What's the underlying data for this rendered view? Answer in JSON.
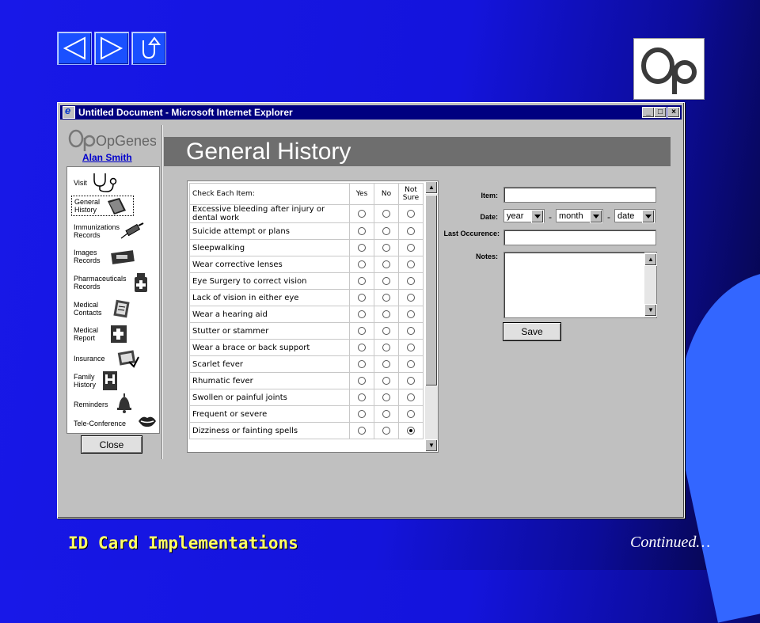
{
  "slide": {
    "footer_title": "ID Card Implementations",
    "footer_continued": "Continued…",
    "nav": {
      "prev_icon": "triangle-left-icon",
      "next_icon": "triangle-right-icon",
      "return_icon": "u-turn-icon"
    },
    "logo_text": "Op"
  },
  "window": {
    "title": "Untitled Document - Microsoft Internet Explorer",
    "controls": [
      "minimize",
      "maximize",
      "close"
    ]
  },
  "app": {
    "brand": "OpGenesis",
    "user_name": "Alan Smith",
    "page_title": "General History",
    "sidebar": [
      {
        "label": "Visit",
        "icon": "stethoscope-icon"
      },
      {
        "label": "General History",
        "icon": "book-icon",
        "selected": true
      },
      {
        "label": "Immunizations Records",
        "icon": "syringe-icon"
      },
      {
        "label": "Images Records",
        "icon": "xray-icon"
      },
      {
        "label": "Pharmaceuticals Records",
        "icon": "medicine-bottle-icon"
      },
      {
        "label": "Medical Contacts",
        "icon": "contacts-icon"
      },
      {
        "label": "Medical Report",
        "icon": "medical-report-icon"
      },
      {
        "label": "Insurance",
        "icon": "insurance-icon"
      },
      {
        "label": "Family History",
        "icon": "family-icon"
      },
      {
        "label": "Reminders",
        "icon": "bell-icon"
      },
      {
        "label": "Tele-Conference",
        "icon": "lips-icon"
      }
    ],
    "close_label": "Close"
  },
  "checklist": {
    "header": {
      "item": "Check Each Item:",
      "yes": "Yes",
      "no": "No",
      "not_sure": "Not Sure"
    },
    "items": [
      {
        "label": "Excessive bleeding after injury or dental work",
        "selected": ""
      },
      {
        "label": "Suicide attempt or plans",
        "selected": ""
      },
      {
        "label": "Sleepwalking",
        "selected": ""
      },
      {
        "label": "Wear corrective lenses",
        "selected": ""
      },
      {
        "label": "Eye Surgery to correct vision",
        "selected": ""
      },
      {
        "label": "Lack of vision in either eye",
        "selected": ""
      },
      {
        "label": "Wear a hearing aid",
        "selected": ""
      },
      {
        "label": "Stutter or stammer",
        "selected": ""
      },
      {
        "label": "Wear a brace or back support",
        "selected": ""
      },
      {
        "label": "Scarlet fever",
        "selected": ""
      },
      {
        "label": "Rhumatic fever",
        "selected": ""
      },
      {
        "label": "Swollen or painful joints",
        "selected": ""
      },
      {
        "label": "Frequent or severe",
        "selected": ""
      },
      {
        "label": "Dizziness or fainting spells",
        "selected": "not_sure"
      }
    ]
  },
  "form": {
    "item_label": "Item:",
    "item_value": "",
    "date_label": "Date:",
    "date_year": "year",
    "date_month": "month",
    "date_day": "date",
    "date_separator": "-",
    "last_occurrence_label": "Last Occurence:",
    "last_occurrence_value": "",
    "notes_label": "Notes:",
    "notes_value": "",
    "save_label": "Save"
  }
}
